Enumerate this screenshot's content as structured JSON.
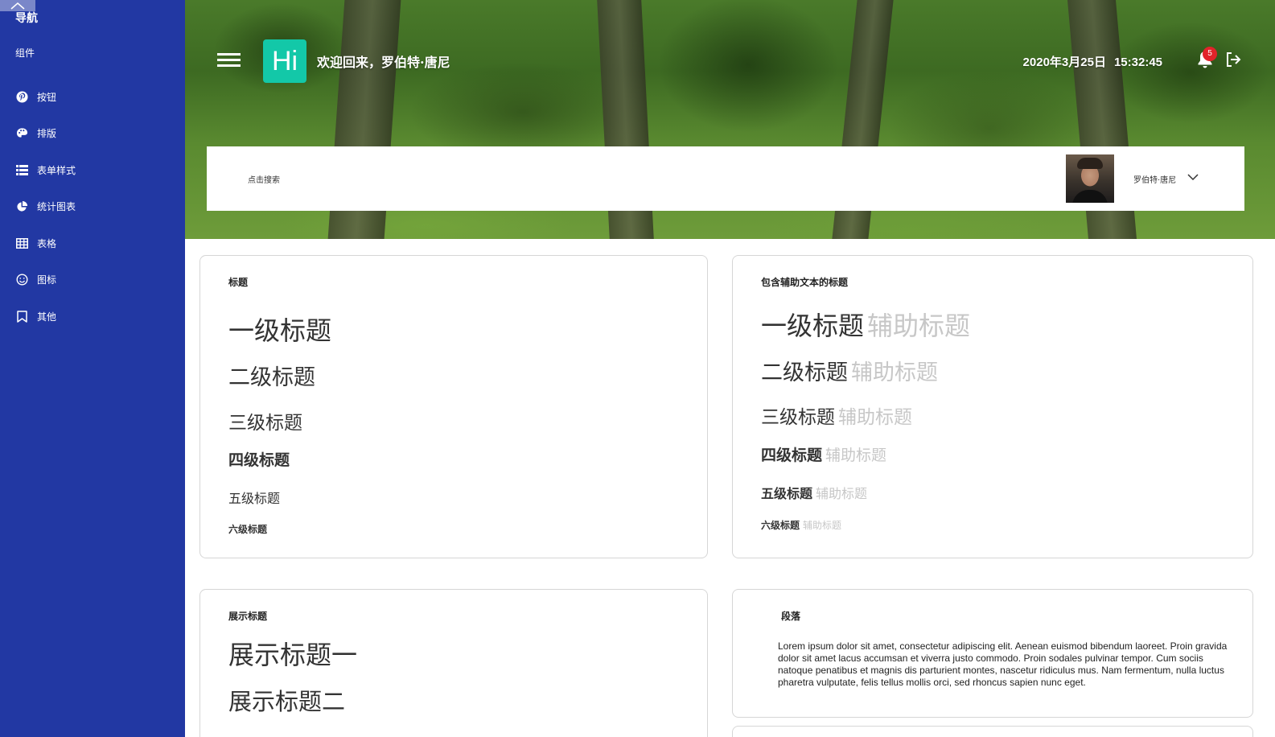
{
  "sidebar": {
    "title": "导航",
    "subtitle": "组件",
    "items": [
      {
        "label": "按钮",
        "icon": "pinterest-icon"
      },
      {
        "label": "排版",
        "icon": "palette-icon"
      },
      {
        "label": "表单样式",
        "icon": "list-icon"
      },
      {
        "label": "统计图表",
        "icon": "pie-chart-icon"
      },
      {
        "label": "表格",
        "icon": "table-icon"
      },
      {
        "label": "图标",
        "icon": "smile-icon"
      },
      {
        "label": "其他",
        "icon": "bookmark-icon"
      }
    ],
    "bg_color": "#2238a3"
  },
  "header": {
    "logo_text": "Hi",
    "logo_color": "#13c8a8",
    "welcome": "欢迎回来，罗伯特·唐尼",
    "date": "2020年3月25日",
    "time": "15:32:45",
    "notification_count": "5",
    "search_label": "点击搜索",
    "user_name": "罗伯特·唐尼"
  },
  "cards": {
    "headings": {
      "title": "标题",
      "items": [
        "一级标题",
        "二级标题",
        "三级标题",
        "四级标题",
        "五级标题",
        "六级标题"
      ]
    },
    "headings_sub": {
      "title": "包含辅助文本的标题",
      "items": [
        "一级标题",
        "二级标题",
        "三级标题",
        "四级标题",
        "五级标题",
        "六级标题"
      ],
      "muted": "辅助标题"
    },
    "display": {
      "title": "展示标题",
      "items": [
        "展示标题一",
        "展示标题二"
      ]
    },
    "paragraph": {
      "title": "段落",
      "text": "Lorem ipsum dolor sit amet, consectetur adipiscing elit. Aenean euismod bibendum laoreet. Proin gravida dolor sit amet lacus accumsan et viverra justo commodo. Proin sodales pulvinar tempor. Cum sociis natoque penatibus et magnis dis parturient montes, nascetur ridiculus mus. Nam fermentum, nulla luctus pharetra vulputate, felis tellus mollis orci, sed rhoncus sapien nunc eget."
    }
  }
}
